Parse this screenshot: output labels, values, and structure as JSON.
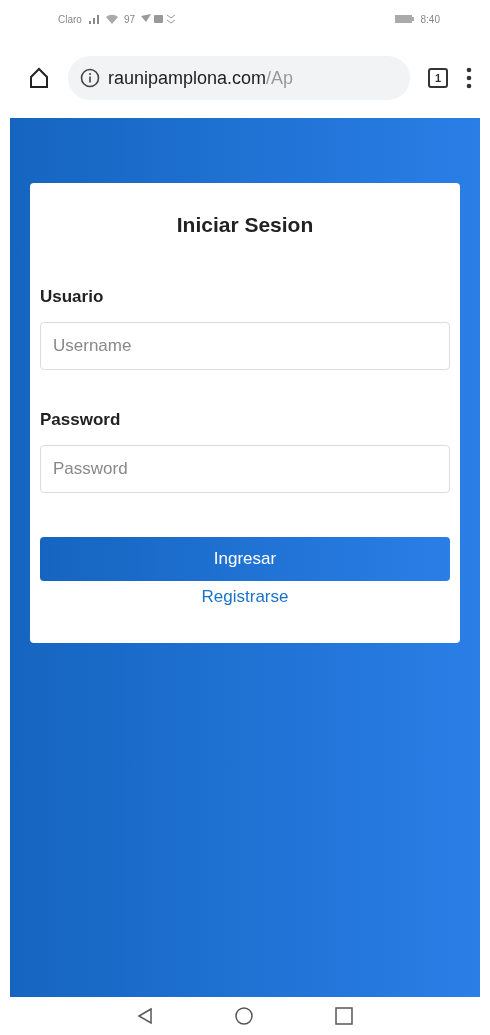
{
  "status_bar": {
    "carrier": "Claro",
    "speed": "97",
    "time": "8:40"
  },
  "browser": {
    "url_host": "raunipamplona.com",
    "url_path": "/Ap",
    "tab_count": "1"
  },
  "login": {
    "title": "Iniciar Sesion",
    "fields": [
      {
        "label": "Usuario",
        "placeholder": "Username"
      },
      {
        "label": "Password",
        "placeholder": "Password"
      }
    ],
    "submit": "Ingresar",
    "register_link": "Registrarse"
  }
}
